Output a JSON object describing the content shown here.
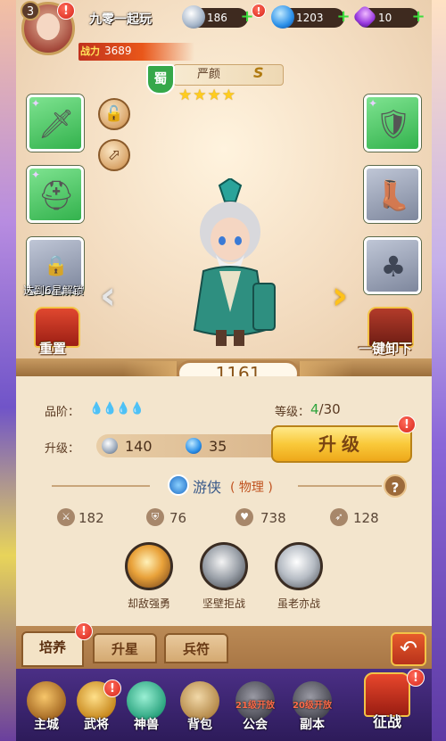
{
  "player": {
    "level": "3",
    "name": "九零一起玩",
    "power_label": "战力",
    "power_value": "3689"
  },
  "resources": {
    "silver": "186",
    "gem": "1203",
    "crystal": "10",
    "plus": "+"
  },
  "hero": {
    "faction": "蜀",
    "name": "严颜",
    "grade": "S",
    "stars": "★★★★"
  },
  "equipment": {
    "lock_icon": "🔓",
    "share_icon": "⬀",
    "unlock_tip": "达到6星解锁",
    "left_arrow": "‹",
    "right_arrow": "›"
  },
  "actions": {
    "reset": "重置",
    "unequip_all": "一键卸下"
  },
  "score": "1161",
  "quality": {
    "label": "品阶：",
    "drops": "💧💧💧💧"
  },
  "level": {
    "label": "等级：",
    "current": "4",
    "max": "/30"
  },
  "upgrade": {
    "label": "升级：",
    "silver_cost": "140",
    "gem_cost": "35",
    "button": "升级"
  },
  "class": {
    "name": "游侠",
    "type": "( 物理 )",
    "help": "?"
  },
  "stats": [
    {
      "value": "182",
      "icon": "sword-icon"
    },
    {
      "value": "76",
      "icon": "shield-icon"
    },
    {
      "value": "738",
      "icon": "heart-icon"
    },
    {
      "value": "128",
      "icon": "boot-icon"
    }
  ],
  "skills": [
    {
      "name": "却敌强勇"
    },
    {
      "name": "坚壁拒战"
    },
    {
      "name": "虽老亦战"
    }
  ],
  "tabs": [
    "培养",
    "升星",
    "兵符"
  ],
  "back": "↶",
  "nav": [
    {
      "label": "主城"
    },
    {
      "label": "武将"
    },
    {
      "label": "神兽"
    },
    {
      "label": "背包"
    },
    {
      "label": "公会",
      "tip": "21级开放"
    },
    {
      "label": "副本",
      "tip": "20级开放"
    }
  ],
  "battle": "征战",
  "alert": "!",
  "colors": {
    "accent": "#f9c93a",
    "panel": "#f3e5cd",
    "nav": "#2d1b5a",
    "green_slot": "#33b24d",
    "gray_slot": "#7e879d"
  }
}
